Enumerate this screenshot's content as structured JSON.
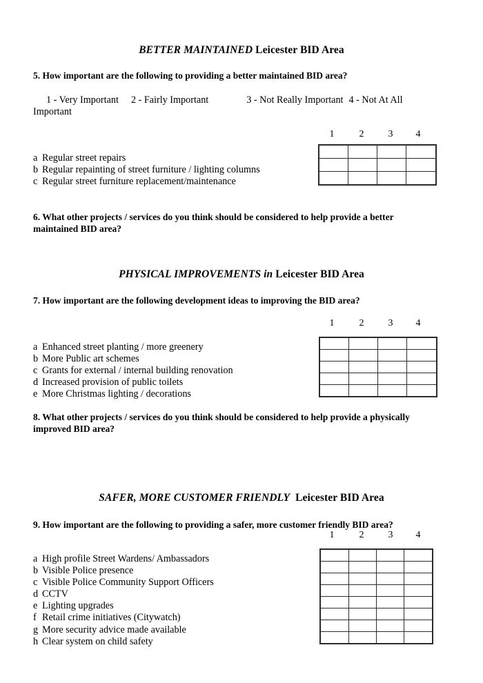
{
  "document": {
    "type": "questionnaire",
    "page_background": "#ffffff",
    "text_color": "#000000"
  },
  "sections": [
    {
      "id": "better-maintained",
      "heading_emphasis": "BETTER MAINTAINED",
      "heading_rest": "Leicester BID Area",
      "question": "5.  How important are the following to providing a better maintained BID area?",
      "scale": {
        "option1": "1 - Very Important",
        "option2": "2 - Fairly Important",
        "option3": "3 - Not Really Important",
        "option4": "4 - Not At All",
        "wrap": "Important"
      },
      "column_headers": [
        "1",
        "2",
        "3",
        "4"
      ],
      "items": [
        {
          "letter": "a",
          "text": "Regular street repairs"
        },
        {
          "letter": "b",
          "text": "Regular repainting of street furniture / lighting columns"
        },
        {
          "letter": "c",
          "text": "Regular street furniture replacement/maintenance"
        }
      ],
      "followup": "6.  What other projects / services do you think should be considered to help provide a better maintained BID area?"
    },
    {
      "id": "physical-improvements",
      "heading_emphasis": "PHYSICAL IMPROVEMENTS in",
      "heading_rest": "Leicester BID Area",
      "question": "7. How important are the following development ideas to improving the BID area?",
      "column_headers": [
        "1",
        "2",
        "3",
        "4"
      ],
      "items": [
        {
          "letter": "a",
          "text": "Enhanced street planting / more greenery"
        },
        {
          "letter": "b",
          "text": "More Public art schemes"
        },
        {
          "letter": "c",
          "text": "Grants for external / internal building renovation"
        },
        {
          "letter": "d",
          "text": "Increased provision of public toilets"
        },
        {
          "letter": "e",
          "text": "More Christmas lighting / decorations"
        }
      ],
      "followup": "8. What other projects / services do you think should be considered to help provide a physically improved BID area?"
    },
    {
      "id": "safer-more-customer-friendly",
      "heading_emphasis": "SAFER, MORE CUSTOMER FRIENDLY",
      "heading_rest": "Leicester BID Area",
      "question": "9. How important are the following to providing a safer, more customer friendly BID area?",
      "column_headers": [
        "1",
        "2",
        "3",
        "4"
      ],
      "items": [
        {
          "letter": "a",
          "text": "High profile Street Wardens/ Ambassadors"
        },
        {
          "letter": "b",
          "text": "Visible Police presence"
        },
        {
          "letter": "c",
          "text": "Visible Police Community Support Officers"
        },
        {
          "letter": "d",
          "text": "CCTV"
        },
        {
          "letter": "e",
          "text": "Lighting upgrades"
        },
        {
          "letter": "f",
          "text": "Retail crime initiatives (Citywatch)"
        },
        {
          "letter": "g",
          "text": "More security advice made available"
        },
        {
          "letter": "h",
          "text": "Clear system on child safety"
        }
      ]
    }
  ]
}
